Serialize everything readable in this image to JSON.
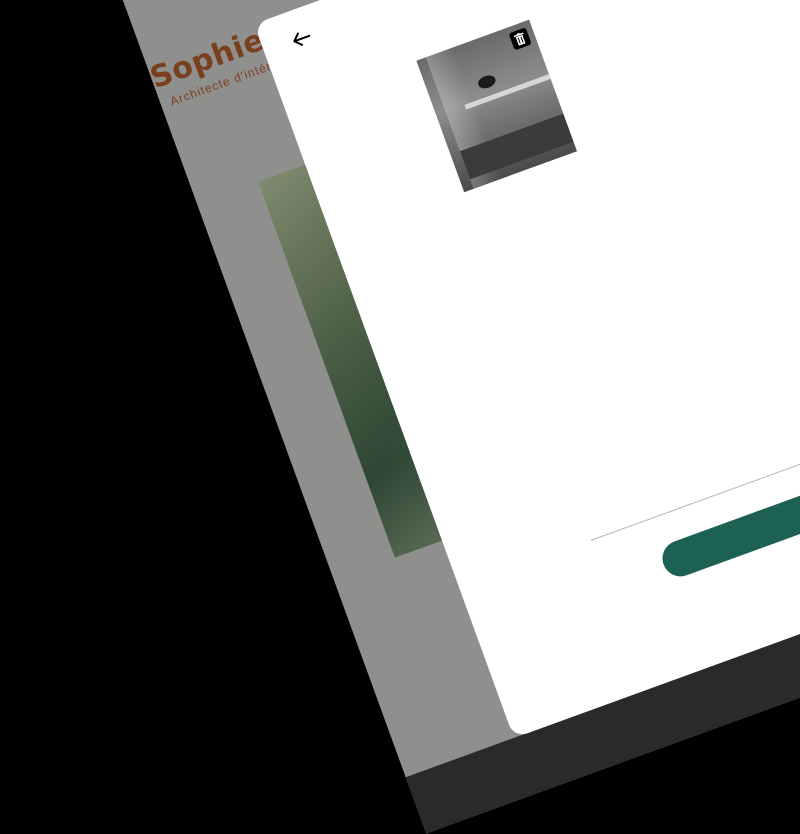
{
  "site": {
    "logo": {
      "name": "Sophie Bluel",
      "subtitle": "Architecte d'intérieur"
    }
  },
  "modal": {
    "back_icon": "arrow-left-icon",
    "gallery_item": {
      "delete_icon": "trash-icon"
    }
  },
  "colors": {
    "brand": "#7a3f1f",
    "accent": "#1d6154",
    "overlay": "#8f8f8d"
  }
}
